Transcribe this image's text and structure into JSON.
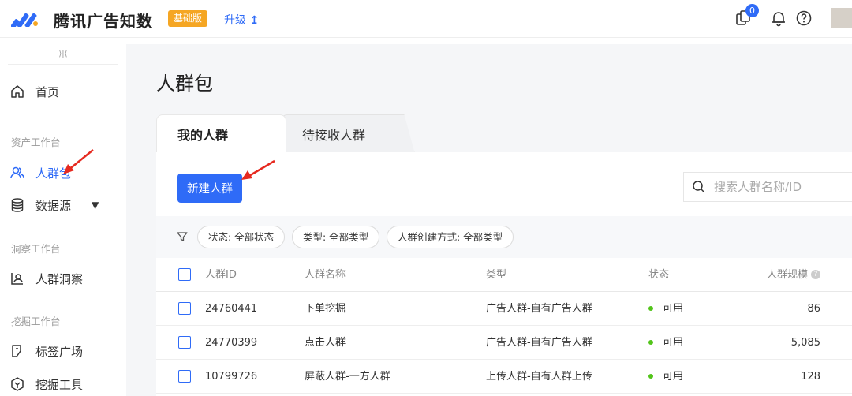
{
  "header": {
    "app_title": "腾讯广告知数",
    "edition_badge": "基础版",
    "upgrade_label": "升级",
    "notification_count": "0",
    "brand_color": "#2f6bf7",
    "badge_color": "#f5a623"
  },
  "sidebar": {
    "collapse_glyph": "⟩|⟨",
    "home": "首页",
    "sections": [
      {
        "label": "资产工作台"
      },
      {
        "label": "洞察工作台"
      },
      {
        "label": "挖掘工作台"
      }
    ],
    "items": [
      {
        "label": "人群包",
        "icon": "people-icon",
        "active": true
      },
      {
        "label": "数据源",
        "icon": "database-icon"
      },
      {
        "label": "人群洞察",
        "icon": "insight-icon"
      },
      {
        "label": "标签广场",
        "icon": "tag-icon"
      },
      {
        "label": "挖掘工具",
        "icon": "mining-icon"
      }
    ]
  },
  "main": {
    "page_title": "人群包",
    "tabs": [
      {
        "label": "我的人群",
        "active": true
      },
      {
        "label": "待接收人群"
      }
    ],
    "new_button": "新建人群",
    "search_placeholder": "搜索人群名称/ID",
    "filters": [
      "状态: 全部状态",
      "类型: 全部类型",
      "人群创建方式: 全部类型"
    ],
    "table": {
      "columns": [
        "人群ID",
        "人群名称",
        "类型",
        "状态",
        "人群规模"
      ],
      "rows": [
        {
          "id": "24760441",
          "name": "下单挖掘",
          "type": "广告人群-自有广告人群",
          "status": "可用",
          "size": "86"
        },
        {
          "id": "24770399",
          "name": "点击人群",
          "type": "广告人群-自有广告人群",
          "status": "可用",
          "size": "5,085"
        },
        {
          "id": "10799726",
          "name": "屏蔽人群-一方人群",
          "type": "上传人群-自有人群上传",
          "status": "可用",
          "size": "128"
        }
      ]
    }
  }
}
